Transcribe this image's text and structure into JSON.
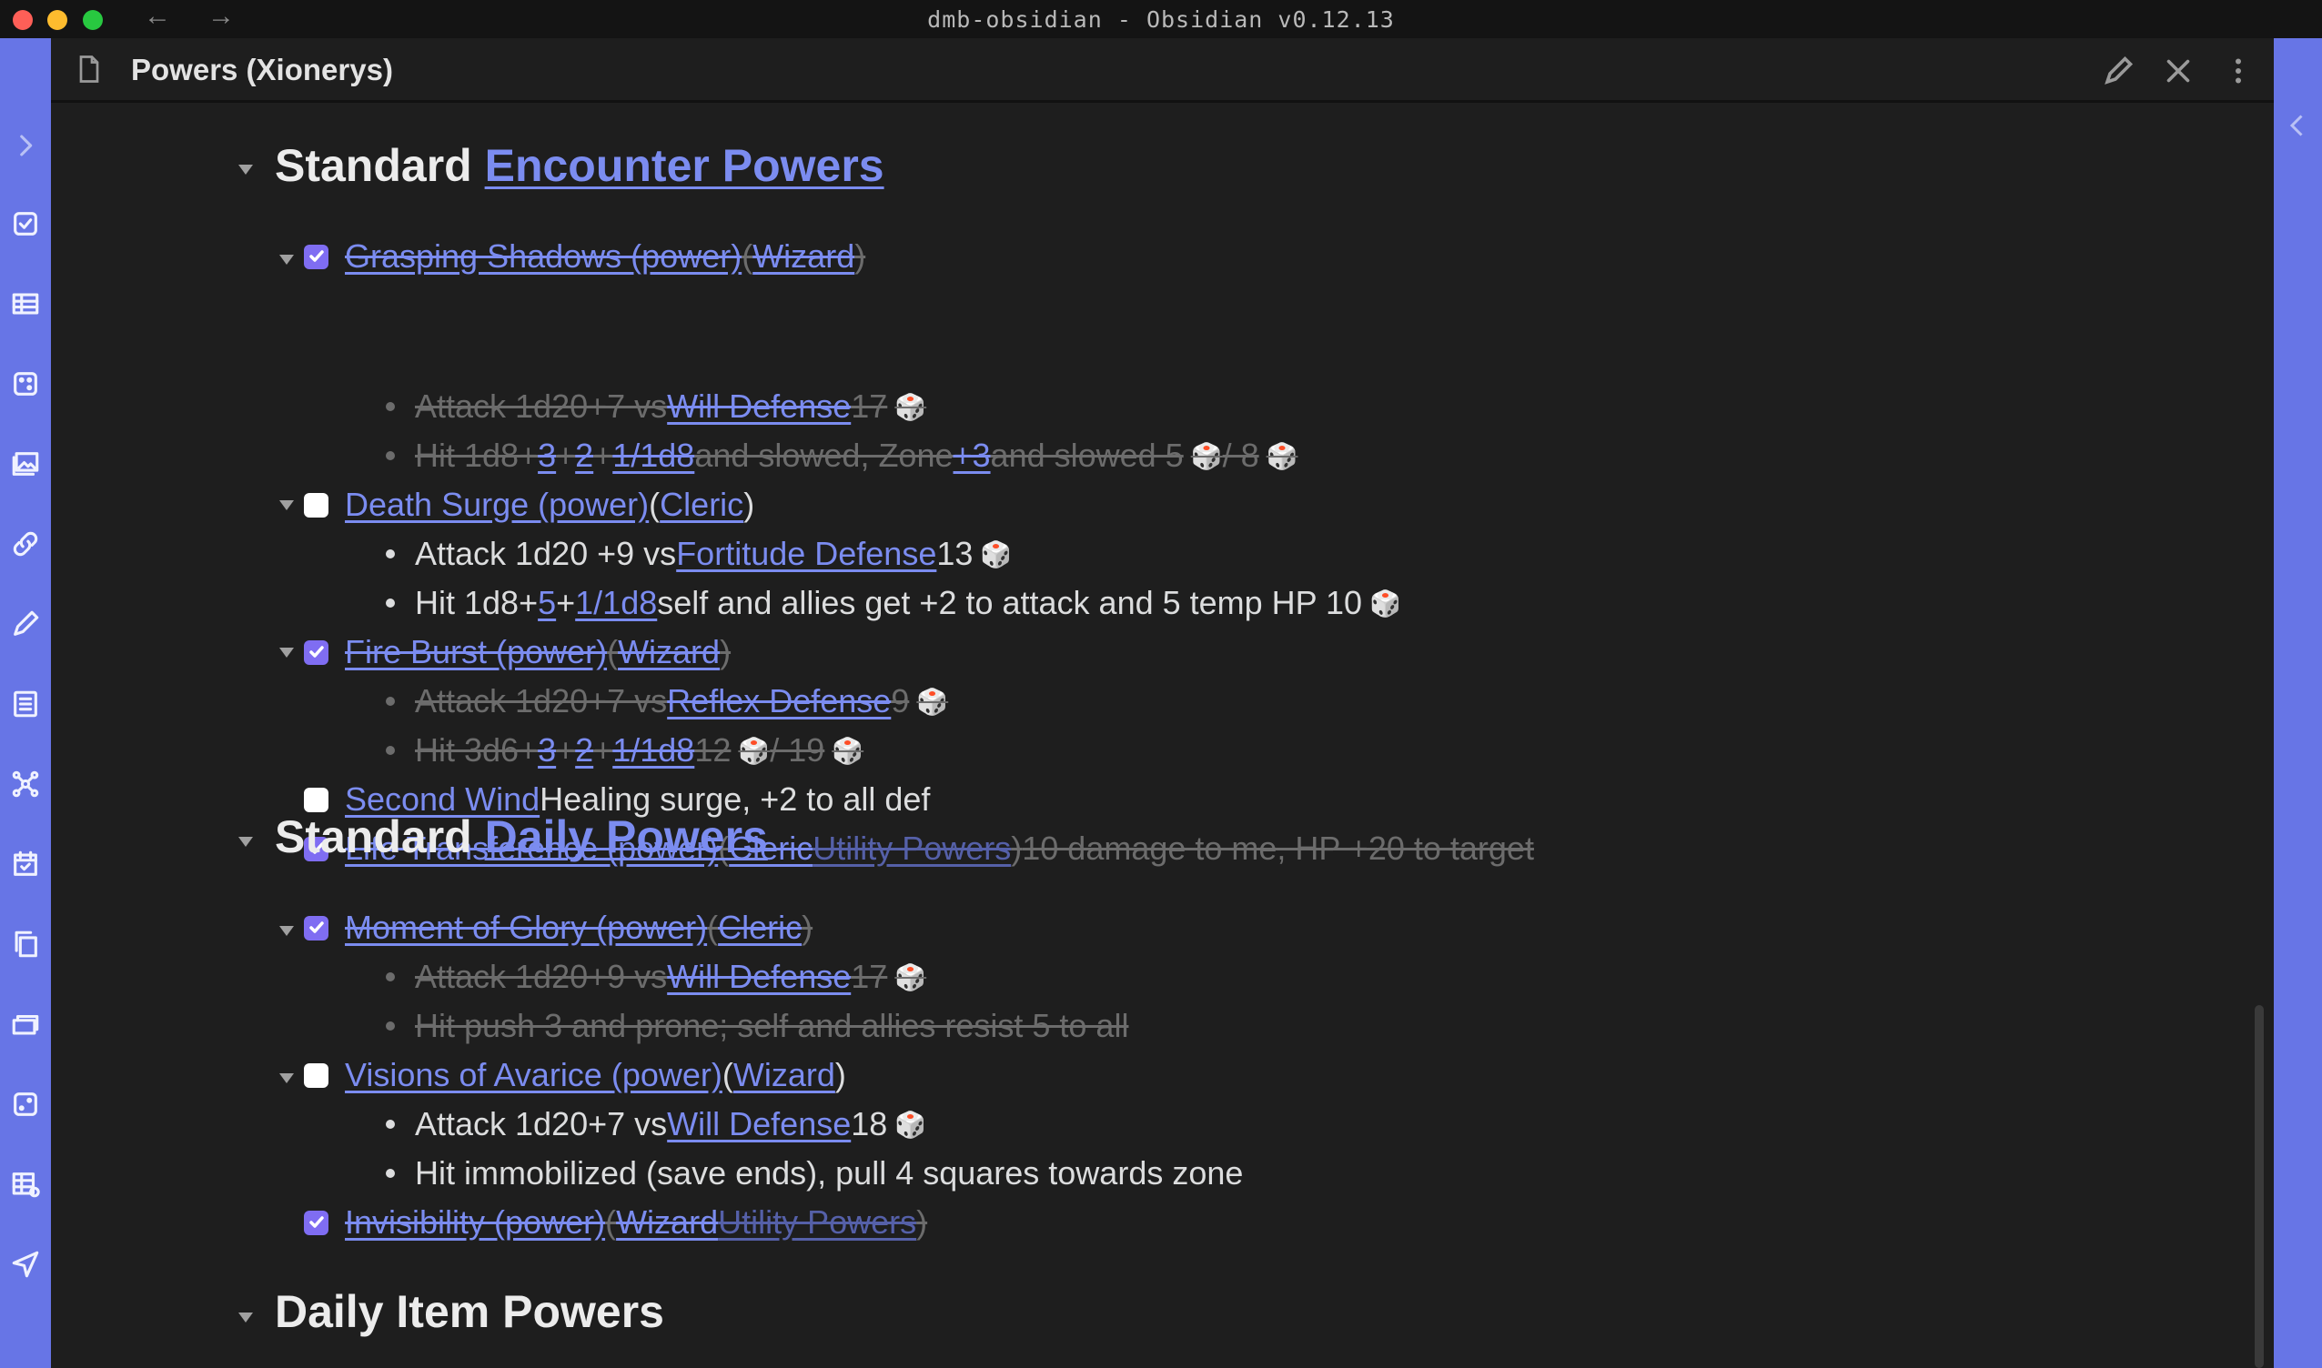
{
  "window": {
    "title": "dmb-obsidian - Obsidian v0.12.13",
    "back": "←",
    "forward": "→"
  },
  "header": {
    "note_title": "Powers (Xionerys)"
  },
  "colors": {
    "accent": "#6775e6",
    "link": "#7b8cf0",
    "checkbox": "#7f6df2",
    "background": "#1e1e1e"
  },
  "ribbon_icons": [
    "chevron-right-icon",
    "checkbox-icon",
    "table-icon",
    "dice-icon",
    "image-icon",
    "link-icon",
    "pencil-icon",
    "list-icon",
    "graph-icon",
    "calendar-icon",
    "copy-icon",
    "cards-icon",
    "dice-icon",
    "table-settings-icon",
    "send-icon"
  ],
  "sections": [
    {
      "heading_prefix": "Standard ",
      "heading_link": "Encounter Powers"
    },
    {
      "heading_prefix": "Standard ",
      "heading_link": "Daily Powers"
    },
    {
      "heading_prefix": "Daily Item Powers",
      "heading_link": ""
    }
  ],
  "encounter": {
    "grasping": {
      "name": "Grasping Shadows (power)",
      "class": "Wizard",
      "attack": {
        "pre": "Attack 1d20+7 vs ",
        "link": "Will Defense",
        "post": " 17"
      },
      "hit": {
        "pre": "Hit 1d8+",
        "l1": "3",
        "l2": "2",
        "l3": "1/1d8",
        "mid": " and slowed, Zone ",
        "l4": "+3",
        "post": " and slowed 5",
        "sep": " / 8"
      }
    },
    "death": {
      "name": "Death Surge (power)",
      "class": "Cleric",
      "attack": {
        "pre": "Attack 1d20 +9 vs ",
        "link": "Fortitude Defense",
        "post": " 13"
      },
      "hit": {
        "pre": "Hit 1d8+",
        "l1": "5",
        "l2": "1/1d8",
        "post": " self and allies get +2 to attack and 5 temp HP 10"
      }
    },
    "fire": {
      "name": "Fire Burst (power)",
      "class": "Wizard",
      "attack": {
        "pre": "Attack 1d20+7 vs ",
        "link": "Reflex Defense",
        "post": " 9"
      },
      "hit": {
        "pre": "Hit 3d6+",
        "l1": "3",
        "l2": "2",
        "l3": "1/1d8",
        "post": " 12",
        "sep": " / 19"
      }
    },
    "second_wind": {
      "name": "Second Wind",
      "desc": " Healing surge, +2 to all def"
    },
    "life": {
      "name": "Life Transference (power)",
      "class": "Cleric",
      "extra": "Utility Powers",
      "desc": " 10 damage to me, HP +20 to target"
    }
  },
  "daily": {
    "moment": {
      "name": "Moment of Glory (power)",
      "class": "Cleric",
      "attack": {
        "pre": "Attack 1d20+9 vs ",
        "link": "Will Defense",
        "post": " 17"
      },
      "hit": "Hit push 3 and prone; self and allies resist 5 to all"
    },
    "visions": {
      "name": "Visions of Avarice (power)",
      "class": "Wizard",
      "attack": {
        "pre": "Attack 1d20+7 vs ",
        "link": "Will Defense",
        "post": " 18"
      },
      "hit": "Hit immobilized (save ends), pull 4 squares towards zone"
    },
    "invis": {
      "name": "Invisibility (power)",
      "class": "Wizard",
      "extra": "Utility Powers"
    }
  },
  "symbols": {
    "plus": "+",
    "open": " (",
    "close": ")",
    "space": " ",
    "dice": "🎲"
  }
}
